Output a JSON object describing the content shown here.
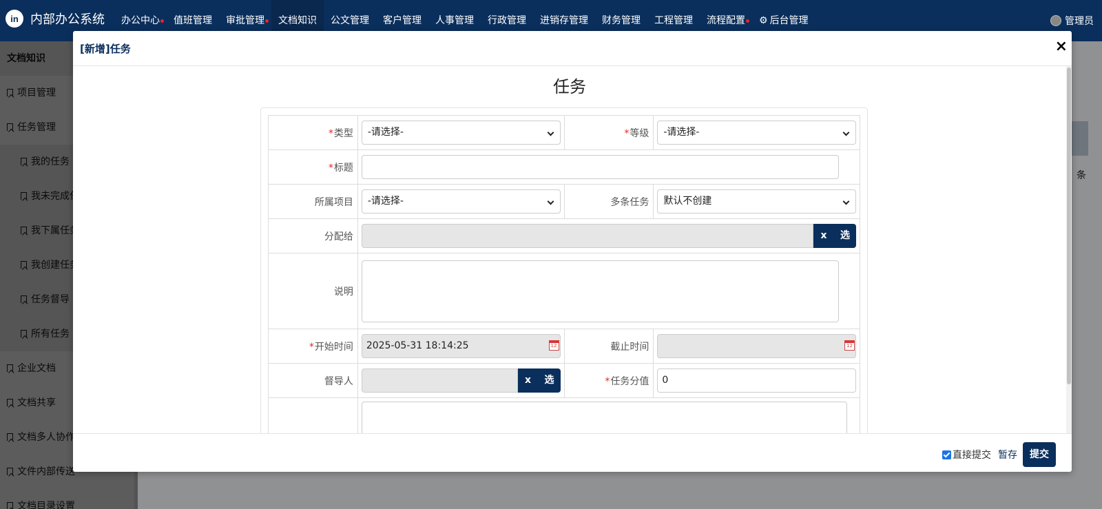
{
  "app": {
    "logo": "in",
    "title": "内部办公系统"
  },
  "nav": {
    "items": [
      {
        "label": "办公中心",
        "dot": true
      },
      {
        "label": "值班管理",
        "dot": false
      },
      {
        "label": "审批管理",
        "dot": true
      },
      {
        "label": "文档知识",
        "dot": false,
        "active": true
      },
      {
        "label": "公文管理",
        "dot": false
      },
      {
        "label": "客户管理",
        "dot": false
      },
      {
        "label": "人事管理",
        "dot": false
      },
      {
        "label": "行政管理",
        "dot": false
      },
      {
        "label": "进销存管理",
        "dot": false
      },
      {
        "label": "财务管理",
        "dot": false
      },
      {
        "label": "工程管理",
        "dot": false
      },
      {
        "label": "流程配置",
        "dot": true
      }
    ],
    "admin": "后台管理",
    "user": "管理员"
  },
  "sidebar": {
    "header": "文档知识",
    "items": [
      {
        "label": "项目管理"
      },
      {
        "label": "任务管理"
      },
      {
        "label": "我的任务"
      },
      {
        "label": "我未完成任务"
      },
      {
        "label": "我下属任务"
      },
      {
        "label": "我创建任务"
      },
      {
        "label": "任务督导"
      },
      {
        "label": "所有任务"
      },
      {
        "label": "企业文档"
      },
      {
        "label": "文档共享"
      },
      {
        "label": "文档多人协作"
      },
      {
        "label": "文件内部传送"
      },
      {
        "label": "文档目录设置"
      }
    ]
  },
  "background": {
    "partial_text": "条"
  },
  "modal": {
    "title": "[新增]任务",
    "close": "×",
    "form_title": "任务",
    "fields": {
      "type": {
        "label": "类型",
        "value": "-请选择-"
      },
      "level": {
        "label": "等级",
        "value": "-请选择-"
      },
      "title": {
        "label": "标题",
        "value": ""
      },
      "project": {
        "label": "所属项目",
        "value": "-请选择-"
      },
      "multi": {
        "label": "多条任务",
        "value": "默认不创建"
      },
      "assign": {
        "label": "分配给",
        "value": "",
        "clear": "x",
        "select": "选"
      },
      "desc": {
        "label": "说明",
        "value": ""
      },
      "start": {
        "label": "开始时间",
        "value": "2025-05-31 18:14:25"
      },
      "end": {
        "label": "截止时间",
        "value": ""
      },
      "supervisor": {
        "label": "督导人",
        "value": "",
        "clear": "x",
        "select": "选"
      },
      "score": {
        "label": "任务分值",
        "value": "0"
      }
    },
    "footer": {
      "direct_submit": "直接提交",
      "direct_submit_checked": true,
      "draft": "暂存",
      "submit": "提交"
    }
  }
}
